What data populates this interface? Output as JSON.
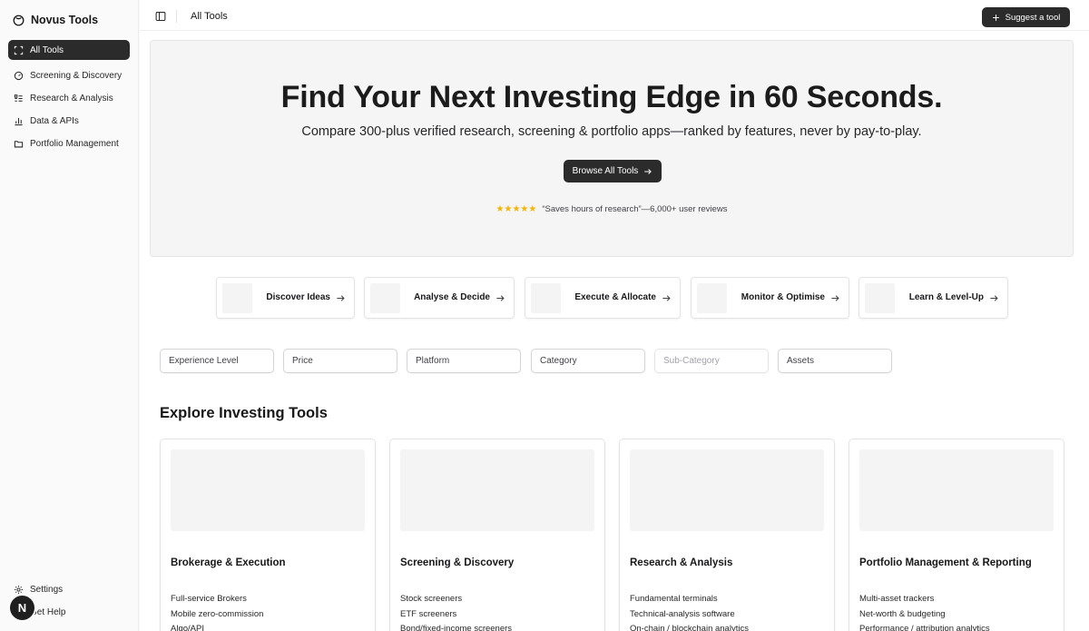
{
  "app": {
    "name": "Novus Tools"
  },
  "sidebar": {
    "items": [
      {
        "label": "All Tools",
        "icon": "scan-icon",
        "active": true
      },
      {
        "label": "Screening & Discovery",
        "icon": "gauge-icon"
      },
      {
        "label": "Research & Analysis",
        "icon": "list-check-icon"
      },
      {
        "label": "Data & APIs",
        "icon": "bar-chart-icon"
      },
      {
        "label": "Portfolio Management",
        "icon": "folder-icon"
      }
    ],
    "bottom": [
      {
        "label": "Settings",
        "icon": "gear-icon"
      },
      {
        "label": "Get Help",
        "icon": "help-icon"
      }
    ],
    "avatar_initial": "N"
  },
  "topbar": {
    "breadcrumb": "All Tools",
    "suggest_label": "Suggest a tool"
  },
  "hero": {
    "title": "Find Your Next Investing Edge in 60 Seconds.",
    "subtitle": "Compare 300-plus verified research, screening & portfolio apps—ranked by features, never by pay-to-play.",
    "cta_label": "Browse All Tools",
    "stars": "★★★★★",
    "rating_value": 5,
    "review_text": "“Saves hours of research”—6,000+ user reviews"
  },
  "stages": [
    {
      "label": "Discover Ideas"
    },
    {
      "label": "Analyse & Decide"
    },
    {
      "label": "Execute & Allocate"
    },
    {
      "label": "Monitor & Optimise"
    },
    {
      "label": "Learn & Level-Up"
    }
  ],
  "filters": [
    {
      "label": "Experience Level",
      "disabled": false
    },
    {
      "label": "Price",
      "disabled": false
    },
    {
      "label": "Platform",
      "disabled": false
    },
    {
      "label": "Category",
      "disabled": false
    },
    {
      "label": "Sub-Category",
      "disabled": true
    },
    {
      "label": "Assets",
      "disabled": false
    }
  ],
  "explore": {
    "title": "Explore Investing Tools",
    "categories": [
      {
        "title": "Brokerage & Execution",
        "items": [
          "Full-service Brokers",
          "Mobile zero-commission",
          "Algo/API"
        ]
      },
      {
        "title": "Screening & Discovery",
        "items": [
          "Stock screeners",
          "ETF screeners",
          "Bond/fixed-income screeners"
        ]
      },
      {
        "title": "Research & Analysis",
        "items": [
          "Fundamental terminals",
          "Technical-analysis software",
          "On-chain / blockchain analytics"
        ]
      },
      {
        "title": "Portfolio Management & Reporting",
        "items": [
          "Multi-asset trackers",
          "Net-worth & budgeting",
          "Performance / attribution analytics"
        ]
      }
    ]
  },
  "colors": {
    "accent_dark": "#2b2b2b",
    "star": "#f5b400",
    "hero_bg": "#f5f5f5"
  }
}
